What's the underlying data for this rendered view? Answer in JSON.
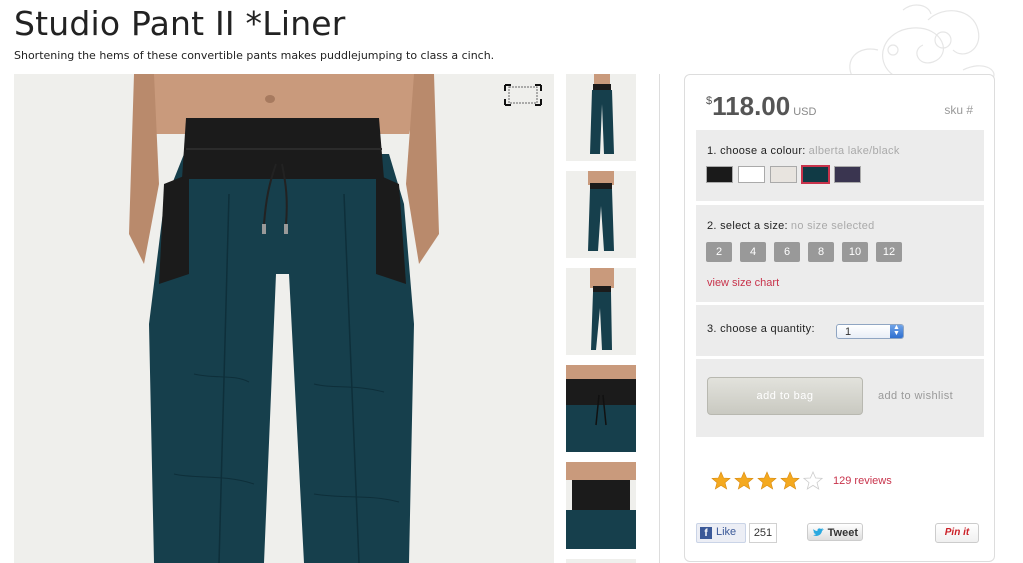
{
  "product": {
    "title": "Studio Pant II *Liner",
    "subtitle": "Shortening the hems of these convertible pants makes puddlejumping to class a cinch."
  },
  "price": {
    "currency_symbol": "$",
    "amount": "118.00",
    "currency_code": "USD",
    "sku_label": "sku #"
  },
  "colour": {
    "label": "1. choose a colour:",
    "selected": "alberta lake/black",
    "swatches": [
      {
        "name": "black",
        "color": "#1a1a1a"
      },
      {
        "name": "white",
        "color": "#ffffff"
      },
      {
        "name": "heathered light",
        "color": "#e8e4df"
      },
      {
        "name": "alberta lake/black",
        "color": "#103a45"
      },
      {
        "name": "purple",
        "color": "#3a3550"
      }
    ]
  },
  "size": {
    "label": "2. select a size:",
    "selected": "no size selected",
    "options": [
      "2",
      "4",
      "6",
      "8",
      "10",
      "12"
    ],
    "size_chart_link": "view size chart"
  },
  "quantity": {
    "label": "3. choose a quantity:",
    "value": "1"
  },
  "actions": {
    "add_to_bag": "add to bag",
    "add_to_wishlist": "add to wishlist"
  },
  "rating": {
    "stars": 4,
    "max": 5,
    "reviews_text": "129 reviews"
  },
  "social": {
    "fb_like": "Like",
    "fb_count": "251",
    "tweet": "Tweet",
    "pin": "Pin it"
  },
  "colors": {
    "accent": "#c8334b",
    "pant": "#163f4c",
    "waistband": "#1b1b1b",
    "skin": "#c99a7c"
  }
}
